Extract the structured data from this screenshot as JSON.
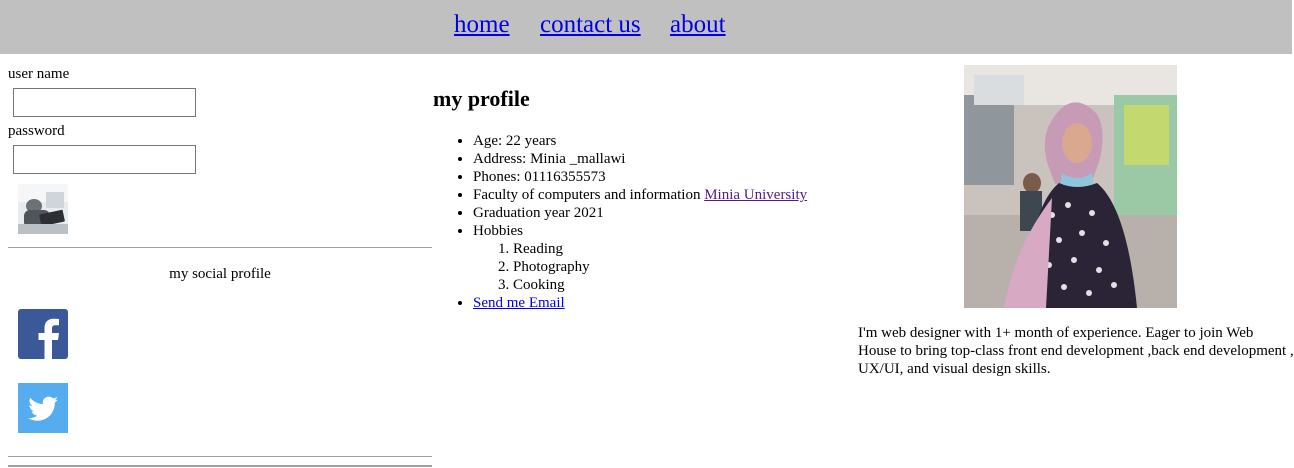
{
  "nav": {
    "home": "home",
    "contact": "contact us",
    "about": "about"
  },
  "login": {
    "username_label": "user name",
    "username_value": "",
    "password_label": "password",
    "password_value": ""
  },
  "social": {
    "title": "my social profile",
    "icons": [
      "facebook-icon",
      "twitter-icon"
    ],
    "colors": {
      "facebook": "#3b5998",
      "twitter": "#55acee"
    }
  },
  "profile": {
    "title": "my profile",
    "age": "Age: 22 years",
    "address": "Address: Minia _mallawi",
    "phones": "Phones: 01116355573",
    "faculty_text": "Faculty of computers and information ",
    "faculty_link": "Minia University",
    "graduation": "Graduation year 2021",
    "hobbies_label": "Hobbies",
    "hobbies": [
      "Reading",
      "Photography",
      "Cooking"
    ],
    "email_link": "Send me Email"
  },
  "bio": "I'm web designer with 1+ month of experience. Eager to join Web House to bring top-class front end development ,back end development , UX/UI, and visual design skills.",
  "colors": {
    "nav_bg": "#c0c0c0",
    "link": "#0000ee",
    "visited_link": "#551a8b"
  }
}
